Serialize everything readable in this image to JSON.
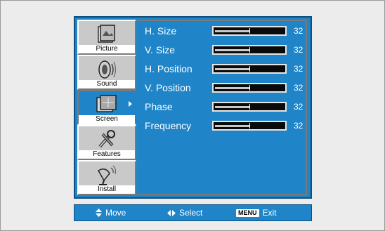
{
  "sidebar": {
    "items": [
      {
        "label": "Picture",
        "icon": "picture-icon",
        "selected": false
      },
      {
        "label": "Sound",
        "icon": "sound-icon",
        "selected": false
      },
      {
        "label": "Screen",
        "icon": "screen-icon",
        "selected": true
      },
      {
        "label": "Features",
        "icon": "features-icon",
        "selected": false
      },
      {
        "label": "Install",
        "icon": "install-icon",
        "selected": false
      }
    ]
  },
  "screen_menu": {
    "items": [
      {
        "label": "H. Size",
        "value": "32",
        "level": 0.5
      },
      {
        "label": "V. Size",
        "value": "32",
        "level": 0.5
      },
      {
        "label": "H. Position",
        "value": "32",
        "level": 0.5
      },
      {
        "label": "V. Position",
        "value": "32",
        "level": 0.5
      },
      {
        "label": "Phase",
        "value": "32",
        "level": 0.5
      },
      {
        "label": "Frequency",
        "value": "32",
        "level": 0.5
      }
    ]
  },
  "footer": {
    "move_label": "Move",
    "select_label": "Select",
    "menu_key": "MENU",
    "exit_label": "Exit"
  },
  "colors": {
    "osd_blue": "#1f85c8",
    "border_dark": "#0e4f80",
    "tab_gray": "#c9c9c9"
  }
}
